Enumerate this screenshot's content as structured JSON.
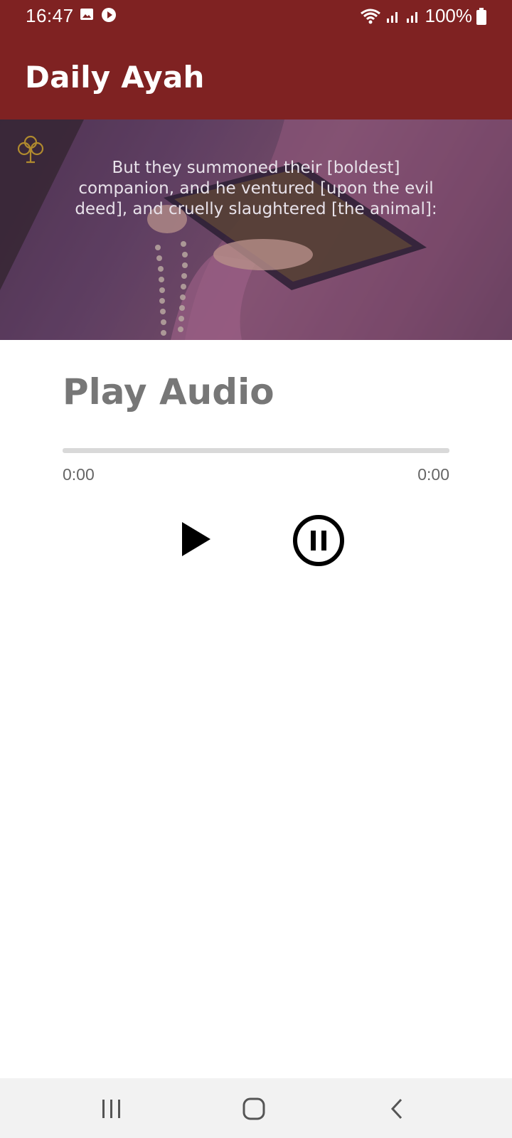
{
  "status_bar": {
    "time": "16:47",
    "battery": "100%",
    "icons": [
      "gallery-icon",
      "app-notification-icon",
      "wifi-icon",
      "signal-icon",
      "signal-icon",
      "battery-icon"
    ]
  },
  "app_bar": {
    "title": "Daily Ayah",
    "color": "#7f2222"
  },
  "banner": {
    "ayah_text": "But they summoned their [boldest] companion, and he ventured [upon the evil deed], and cruelly slaughtered [the animal]:",
    "icon": "ornament-logo-icon"
  },
  "player": {
    "heading": "Play Audio",
    "current_time": "0:00",
    "total_time": "0:00",
    "progress": 0,
    "play_icon": "play-icon",
    "pause_icon": "pause-circle-icon"
  },
  "nav_bar": {
    "buttons": [
      "recent-apps-icon",
      "home-icon",
      "back-icon"
    ]
  }
}
